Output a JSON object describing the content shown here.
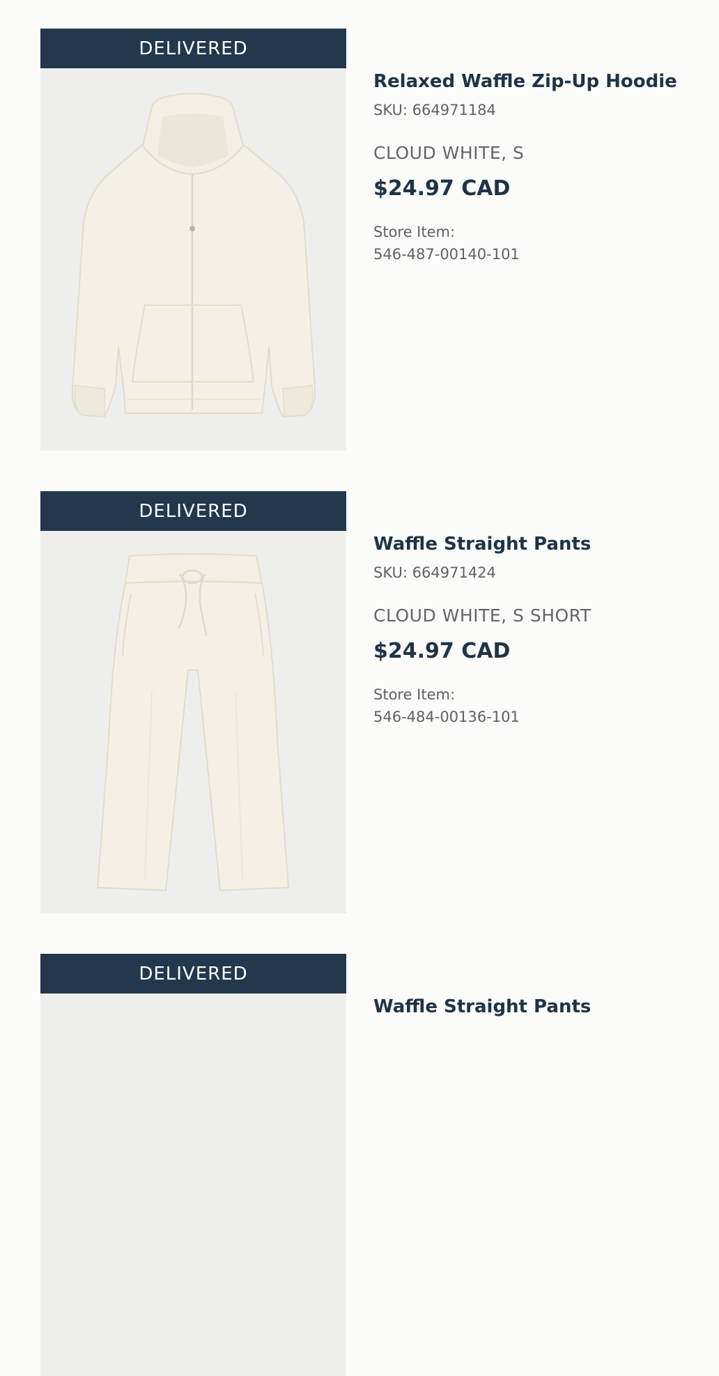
{
  "orders": [
    {
      "status": "DELIVERED",
      "name": "Relaxed Waffle Zip-Up Hoodie",
      "sku": "SKU: 664971184",
      "variant": "CLOUD WHITE, S",
      "price": "$24.97 CAD",
      "store_label": "Store Item:",
      "store_number": "546-487-00140-101",
      "image": "hoodie-image"
    },
    {
      "status": "DELIVERED",
      "name": "Waffle Straight Pants",
      "sku": "SKU: 664971424",
      "variant": "CLOUD WHITE, S SHORT",
      "price": "$24.97 CAD",
      "store_label": "Store Item:",
      "store_number": "546-484-00136-101",
      "image": "pants-image"
    },
    {
      "status": "DELIVERED",
      "name": "Waffle Straight Pants",
      "image": "pants-image"
    }
  ],
  "colors": {
    "banner": "#22384c",
    "text_primary": "#1f3347",
    "text_secondary": "#5e6266",
    "image_bg": "#eeeeed",
    "garment": "#f4f0e6"
  }
}
